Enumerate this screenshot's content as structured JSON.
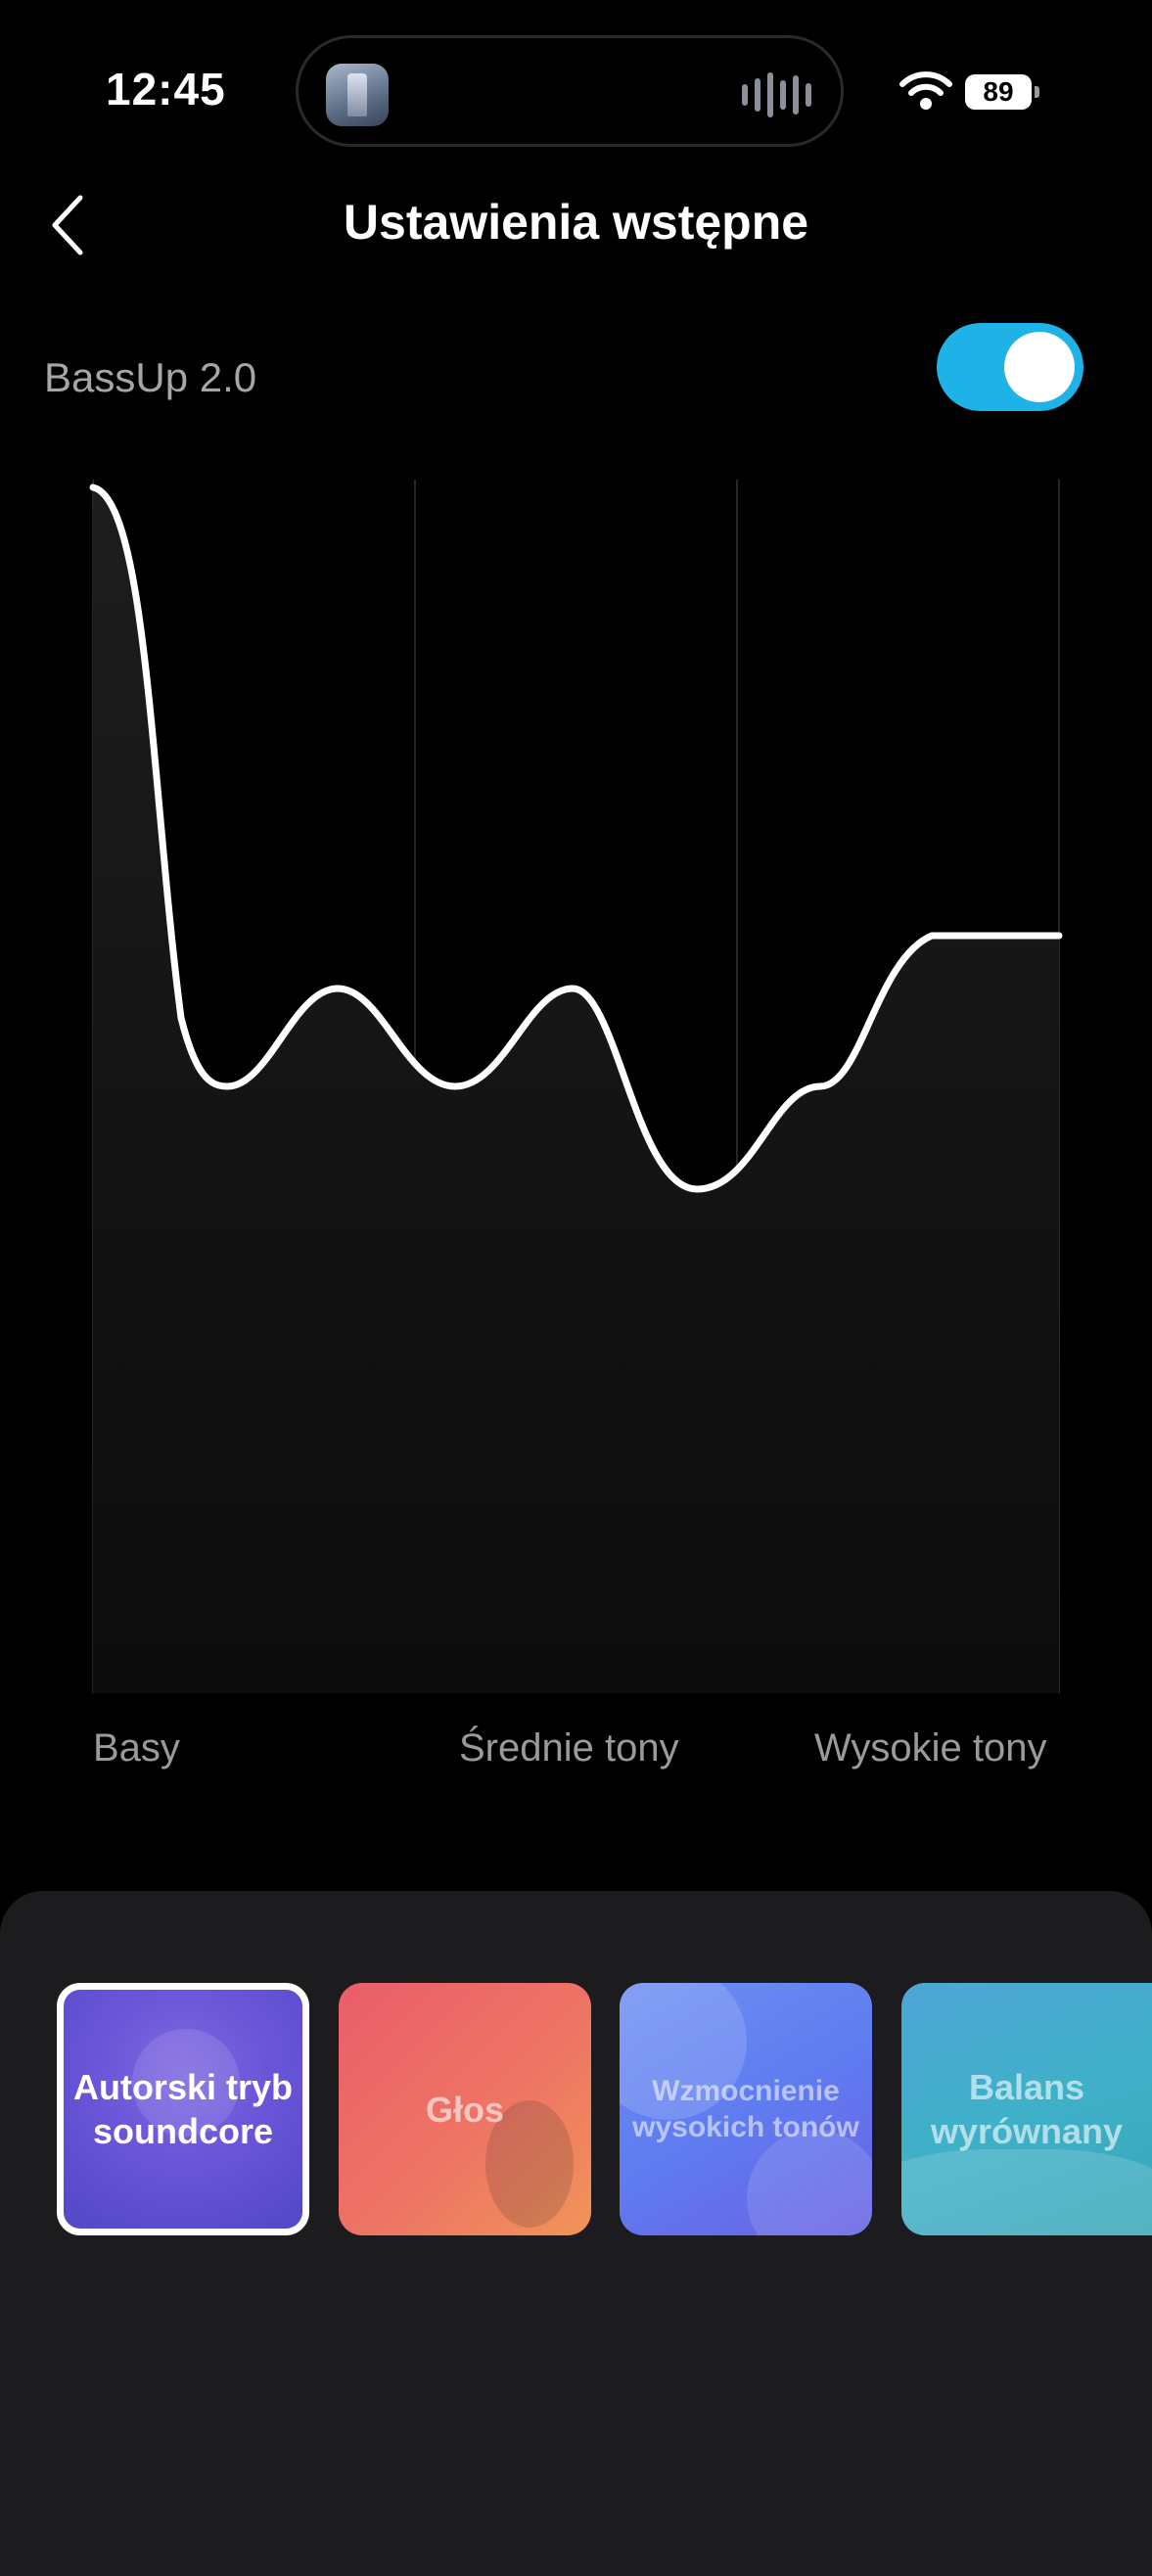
{
  "status_bar": {
    "time": "12:45",
    "battery": "89",
    "icons": [
      "wifi-icon",
      "battery-icon",
      "audio-wave-icon"
    ]
  },
  "nav": {
    "title": "Ustawienia wstępne",
    "back_icon": "chevron-left-icon"
  },
  "bassup": {
    "label": "BassUp 2.0",
    "enabled": true,
    "accent": "#1fb2e7"
  },
  "eq_chart": {
    "band_labels": [
      "Basy",
      "Średnie tony",
      "Wysokie tony"
    ]
  },
  "presets": [
    {
      "label": "Autorski tryb soundcore",
      "selected": true
    },
    {
      "label": "Głos",
      "selected": false
    },
    {
      "label": "Wzmocnienie wysokich tonów",
      "selected": false
    },
    {
      "label": "Balans wyrównany",
      "selected": false
    }
  ]
}
